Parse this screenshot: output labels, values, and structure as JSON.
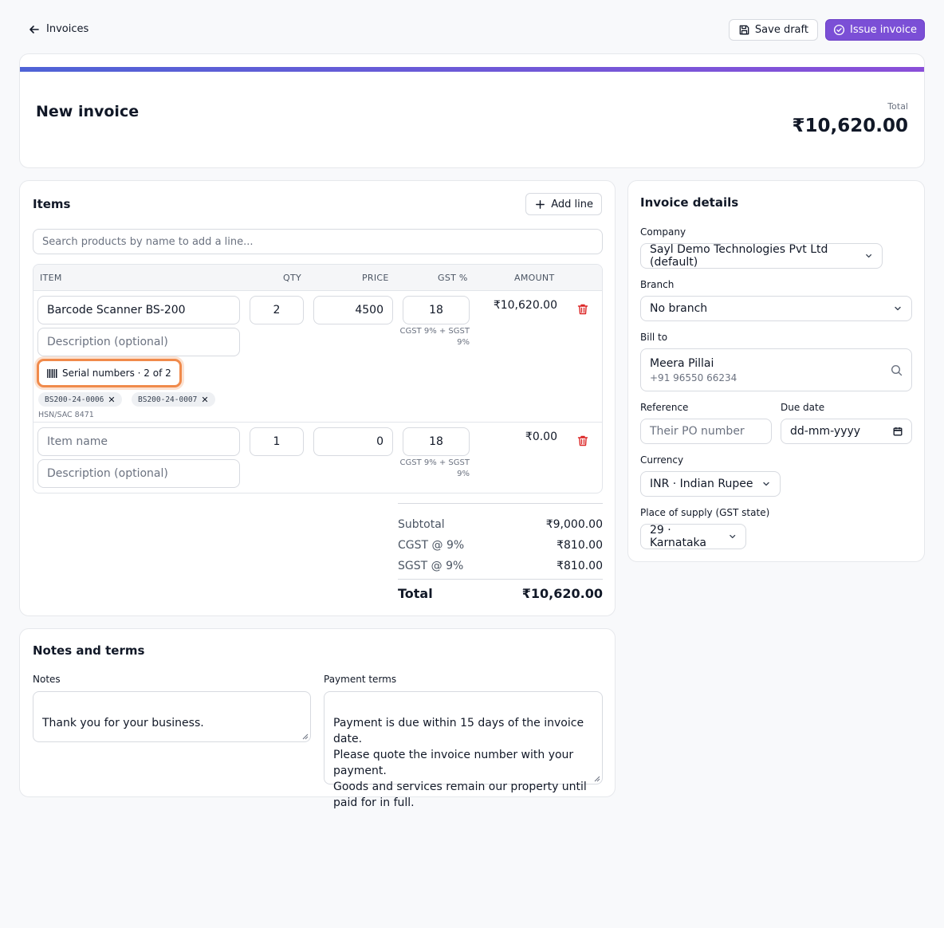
{
  "topbar": {
    "back_label": "Invoices",
    "save_draft_label": "Save draft",
    "issue_label": "Issue invoice"
  },
  "header": {
    "title": "New invoice",
    "total_label": "Total",
    "total_value": "₹10,620.00",
    "accent_colors": [
      "#4f63d6",
      "#8a4fd8"
    ]
  },
  "items": {
    "title": "Items",
    "add_line_label": "Add line",
    "search_placeholder": "Search products by name to add a line...",
    "columns": [
      "ITEM",
      "QTY",
      "PRICE",
      "GST %",
      "AMOUNT"
    ],
    "lines": [
      {
        "name": "Barcode Scanner BS-200",
        "description_placeholder": "Description (optional)",
        "qty": "2",
        "price": "4500",
        "gst": "18",
        "gst_note": "CGST 9% + SGST 9%",
        "amount": "₹10,620.00",
        "serial_button_label": "Serial numbers · 2 of 2",
        "serials": [
          "BS200-24-0006",
          "BS200-24-0007"
        ],
        "hsn": "HSN/SAC 8471"
      },
      {
        "name_placeholder": "Item name",
        "description_placeholder": "Description (optional)",
        "qty": "1",
        "price": "0",
        "gst": "18",
        "gst_note": "CGST 9% + SGST 9%",
        "amount": "₹0.00"
      }
    ],
    "totals": {
      "subtotal_label": "Subtotal",
      "subtotal_value": "₹9,000.00",
      "cgst_label": "CGST @ 9%",
      "cgst_value": "₹810.00",
      "sgst_label": "SGST @ 9%",
      "sgst_value": "₹810.00",
      "total_label": "Total",
      "total_value": "₹10,620.00"
    }
  },
  "details": {
    "title": "Invoice details",
    "company_label": "Company",
    "company_value": "Sayl Demo Technologies Pvt Ltd (default)",
    "branch_label": "Branch",
    "branch_value": "No branch",
    "bill_to_label": "Bill to",
    "bill_to_name": "Meera Pillai",
    "bill_to_phone": "+91 96550 66234",
    "reference_label": "Reference",
    "reference_placeholder": "Their PO number",
    "due_date_label": "Due date",
    "due_date_placeholder": "dd-mm-yyyy",
    "currency_label": "Currency",
    "currency_value": "INR · Indian Rupee",
    "supply_label": "Place of supply (GST state)",
    "supply_value": "29 · Karnataka"
  },
  "notes": {
    "title": "Notes and terms",
    "notes_label": "Notes",
    "notes_value": "Thank you for your business.",
    "terms_label": "Payment terms",
    "terms_value": "Payment is due within 15 days of the invoice date.\nPlease quote the invoice number with your payment.\nGoods and services remain our property until paid for in full."
  },
  "colors": {
    "primary": "#7b4fd6",
    "danger": "#dc2626",
    "highlight": "#f08a4b"
  }
}
